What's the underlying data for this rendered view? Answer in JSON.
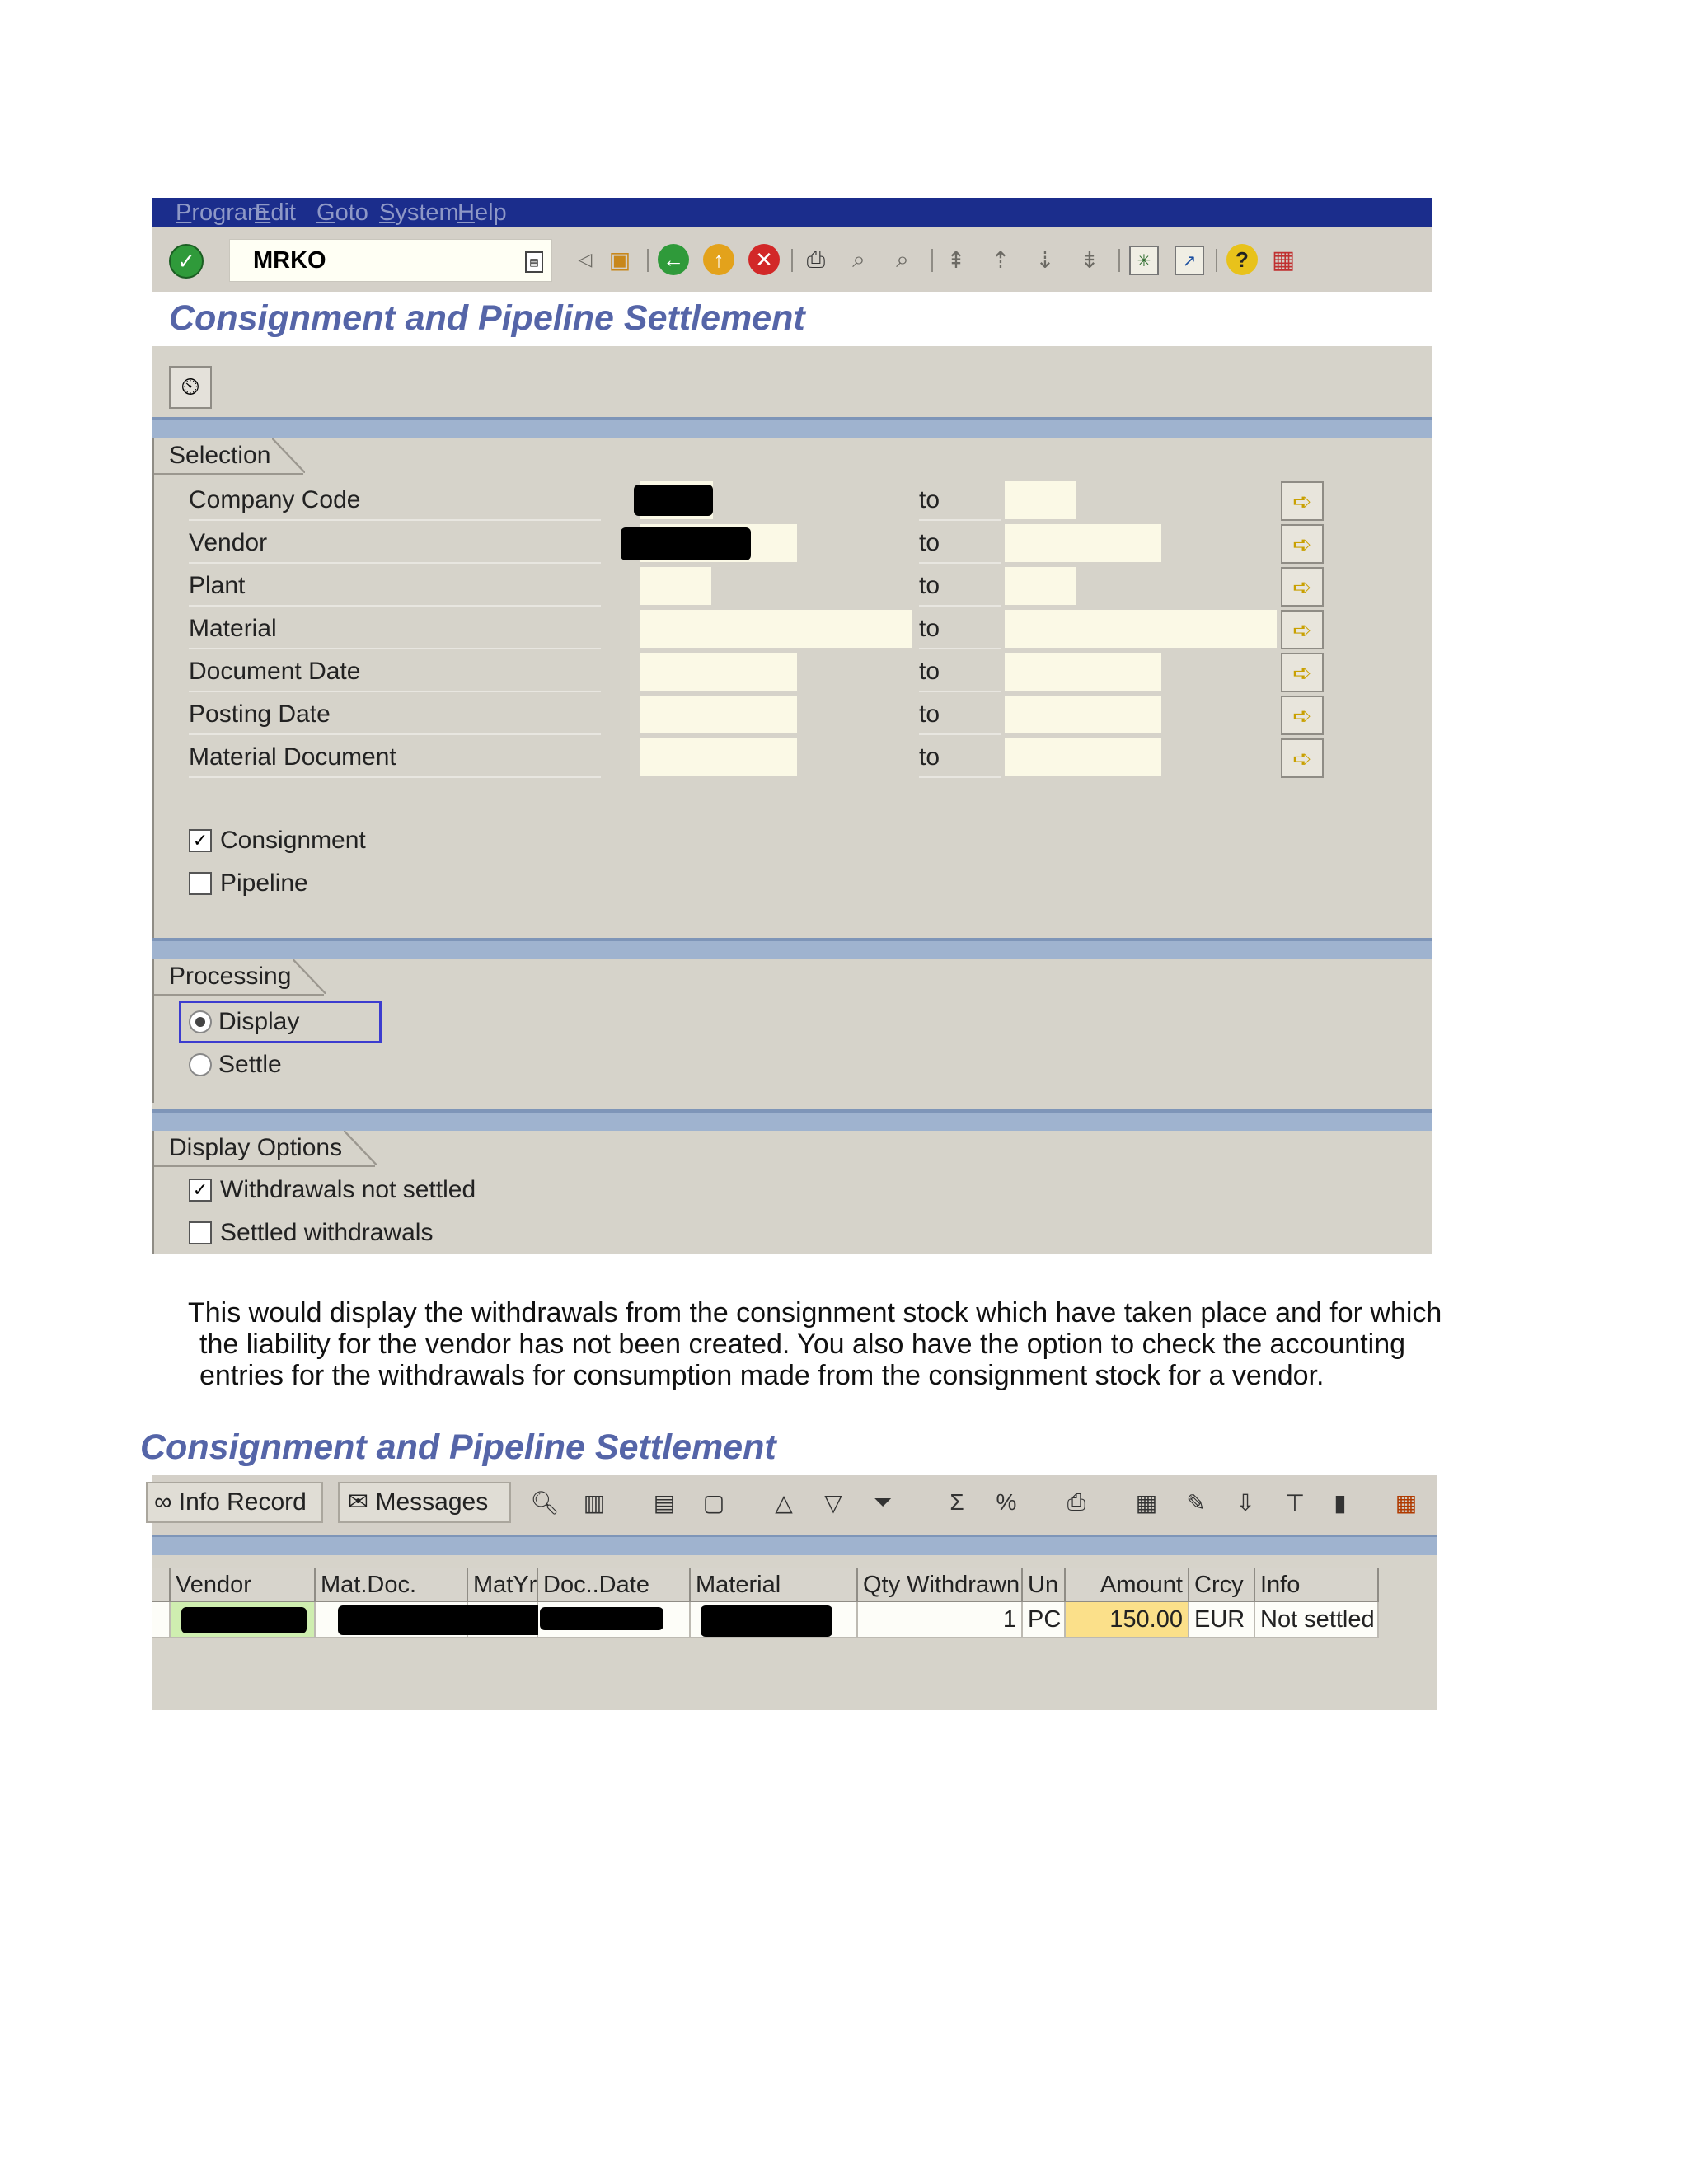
{
  "menu": {
    "items": [
      {
        "u": "P",
        "rest": "rogram"
      },
      {
        "u": "E",
        "rest": "dit"
      },
      {
        "u": "G",
        "rest": "oto"
      },
      {
        "u": "S",
        "rest": "ystem"
      },
      {
        "u": "H",
        "rest": "elp"
      }
    ]
  },
  "toolbar": {
    "command_value": "MRKO"
  },
  "screen1": {
    "title": "Consignment and Pipeline Settlement",
    "selection": {
      "title": "Selection",
      "fields": [
        {
          "label": "Company Code",
          "to": "to"
        },
        {
          "label": "Vendor",
          "to": "to"
        },
        {
          "label": "Plant",
          "to": "to"
        },
        {
          "label": "Material",
          "to": "to"
        },
        {
          "label": "Document Date",
          "to": "to"
        },
        {
          "label": "Posting Date",
          "to": "to"
        },
        {
          "label": "Material Document",
          "to": "to"
        }
      ],
      "checkboxes": [
        {
          "label": "Consignment",
          "checked": true
        },
        {
          "label": "Pipeline",
          "checked": false
        }
      ]
    },
    "processing": {
      "title": "Processing",
      "options": [
        {
          "label": "Display",
          "selected": true
        },
        {
          "label": "Settle",
          "selected": false
        }
      ]
    },
    "display_options": {
      "title": "Display Options",
      "checkboxes": [
        {
          "label": "Withdrawals not settled",
          "checked": true
        },
        {
          "label": "Settled withdrawals",
          "checked": false
        }
      ]
    }
  },
  "paragraph": {
    "lines": [
      "This would display the withdrawals from the consignment stock which have taken place and for which",
      "the liability for the vendor has not been created. You also have the option to check the accounting",
      "entries for the withdrawals for consumption made from the consignment stock for a vendor."
    ]
  },
  "screen2": {
    "title": "Consignment and Pipeline Settlement",
    "toolbar": {
      "info_record": "Info Record",
      "messages": "Messages"
    },
    "table": {
      "headers": [
        "Vendor",
        "Mat.Doc.",
        "MatYr",
        "Doc..Date",
        "Material",
        "Qty Withdrawn",
        "Un",
        "Amount",
        "Crcy",
        "Info"
      ],
      "row": {
        "qty": "1",
        "unit": "PC",
        "amount": "150.00",
        "currency": "EUR",
        "info": "Not settled"
      }
    }
  },
  "colors": {
    "menubar": "#1b2d8c",
    "title_text": "#5565a8",
    "panel": "#d6d3ca",
    "band": "#9fb3cf",
    "input_bg": "#fbf9e6",
    "amount_bg": "#fbe08a",
    "focus": "#3c3ccf"
  },
  "icons": [
    "check-icon",
    "dropdown-icon",
    "back-arrow-icon",
    "save-icon",
    "green-back-icon",
    "exit-icon",
    "cancel-icon",
    "print-icon",
    "find-icon",
    "find-next-icon",
    "first-page-icon",
    "previous-page-icon",
    "next-page-icon",
    "last-page-icon",
    "new-session-icon",
    "shortcut-icon",
    "help-icon",
    "customize-icon",
    "execute-icon",
    "multiple-selection-arrow-icon"
  ]
}
